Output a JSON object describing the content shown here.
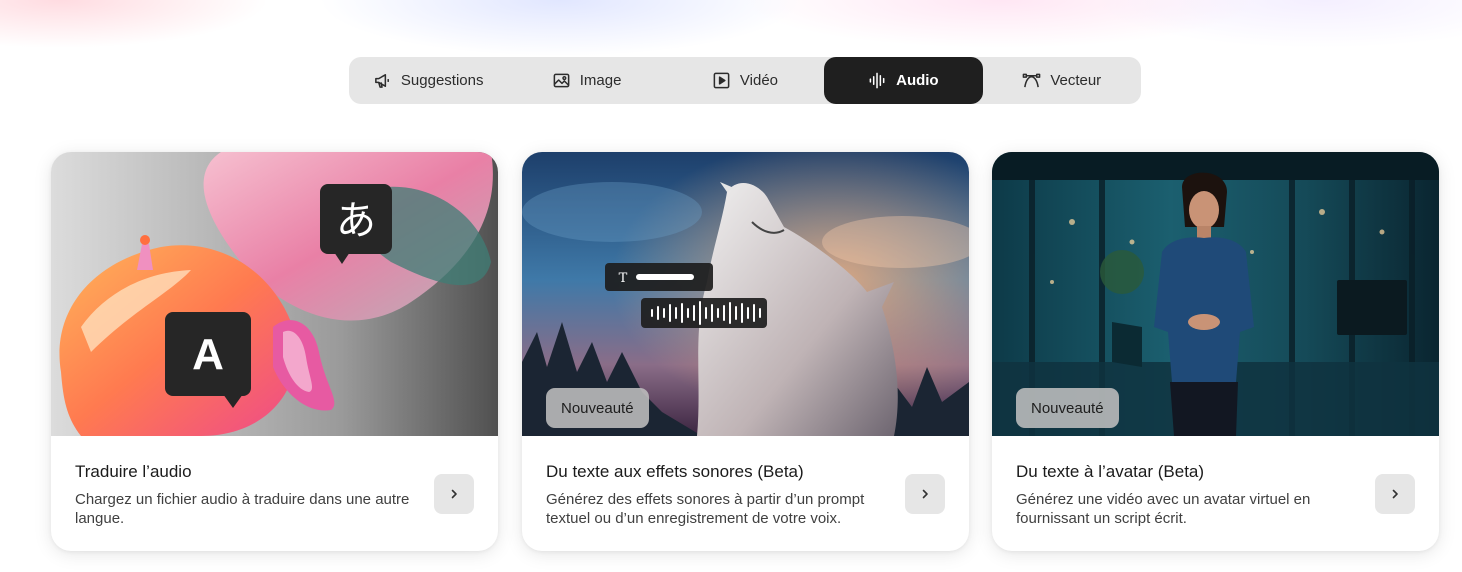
{
  "tabs": [
    {
      "label": "Suggestions",
      "icon": "megaphone-icon",
      "active": false
    },
    {
      "label": "Image",
      "icon": "image-icon",
      "active": false
    },
    {
      "label": "Vidéo",
      "icon": "play-icon",
      "active": false
    },
    {
      "label": "Audio",
      "icon": "audio-wave-icon",
      "active": true
    },
    {
      "label": "Vecteur",
      "icon": "vector-pen-icon",
      "active": false
    }
  ],
  "cards": [
    {
      "title": "Traduire l’audio",
      "description": "Chargez un fichier audio à traduire dans une autre langue.",
      "badge": "",
      "bubble_letters": [
        "あ",
        "A"
      ],
      "image": "abstract-3d-translation-illustration"
    },
    {
      "title": "Du texte aux effets sonores (Beta)",
      "description": "Générez des effets sonores à partir d’un prompt textuel ou d’un enregistrement de votre voix.",
      "badge": "Nouveauté",
      "text_chip_glyph": "T",
      "image": "howling-wolf-night-sky"
    },
    {
      "title": "Du texte à l’avatar (Beta)",
      "description": "Générez une vidéo avec un avatar virtuel en fournissant un script écrit.",
      "badge": "Nouveauté",
      "image": "virtual-avatar-woman-in-office"
    }
  ],
  "colors": {
    "active_tab_bg": "#1f1f1f",
    "tabbar_bg": "#e6e6e6",
    "arrow_button_bg": "#e6e6e6",
    "badge_bg": "#bebebe"
  }
}
